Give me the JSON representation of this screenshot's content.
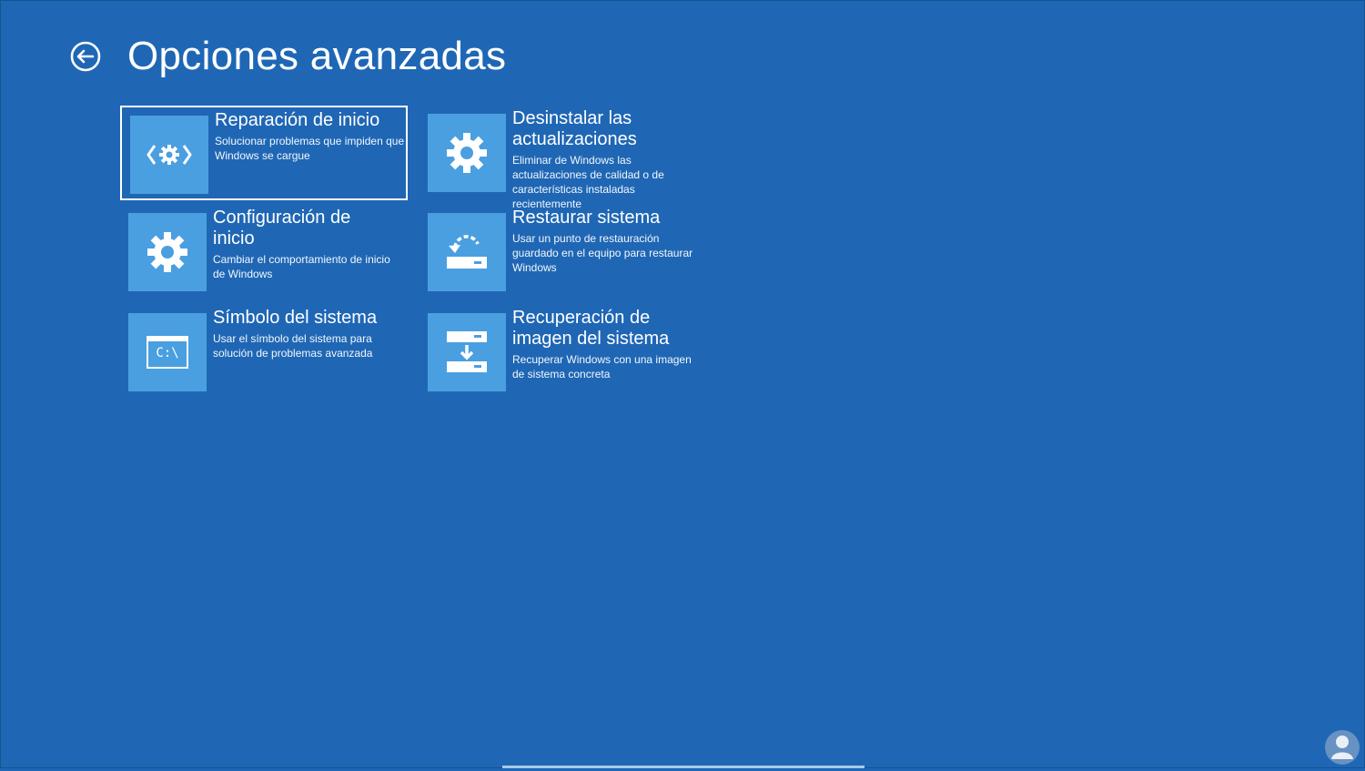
{
  "header": {
    "title": "Opciones avanzadas",
    "back_icon": "back-arrow-icon"
  },
  "options": [
    {
      "title": "Reparación de inicio",
      "description": "Solucionar problemas que impiden que Windows se cargue",
      "icon": "startup-repair-icon",
      "focused": true
    },
    {
      "title": "Desinstalar las actualizaciones",
      "description": "Eliminar de Windows las actualizaciones de calidad o de características instaladas recientemente",
      "icon": "gear-icon"
    },
    {
      "title": "Configuración de inicio",
      "description": "Cambiar el comportamiento de inicio de Windows",
      "icon": "gear-icon"
    },
    {
      "title": "Restaurar sistema",
      "description": "Usar un punto de restauración guardado en el equipo para restaurar Windows",
      "icon": "system-restore-icon"
    },
    {
      "title": "Símbolo del sistema",
      "description": "Usar el símbolo del sistema para solución de problemas avanzada",
      "icon": "command-prompt-icon",
      "icon_text": "C:\\"
    },
    {
      "title": "Recuperación de imagen del sistema",
      "description": "Recuperar Windows con una imagen de sistema concreta",
      "icon": "system-image-recovery-icon"
    }
  ],
  "colors": {
    "background": "#1f67b5",
    "tile": "#4a9fe0",
    "text": "#ffffff"
  }
}
